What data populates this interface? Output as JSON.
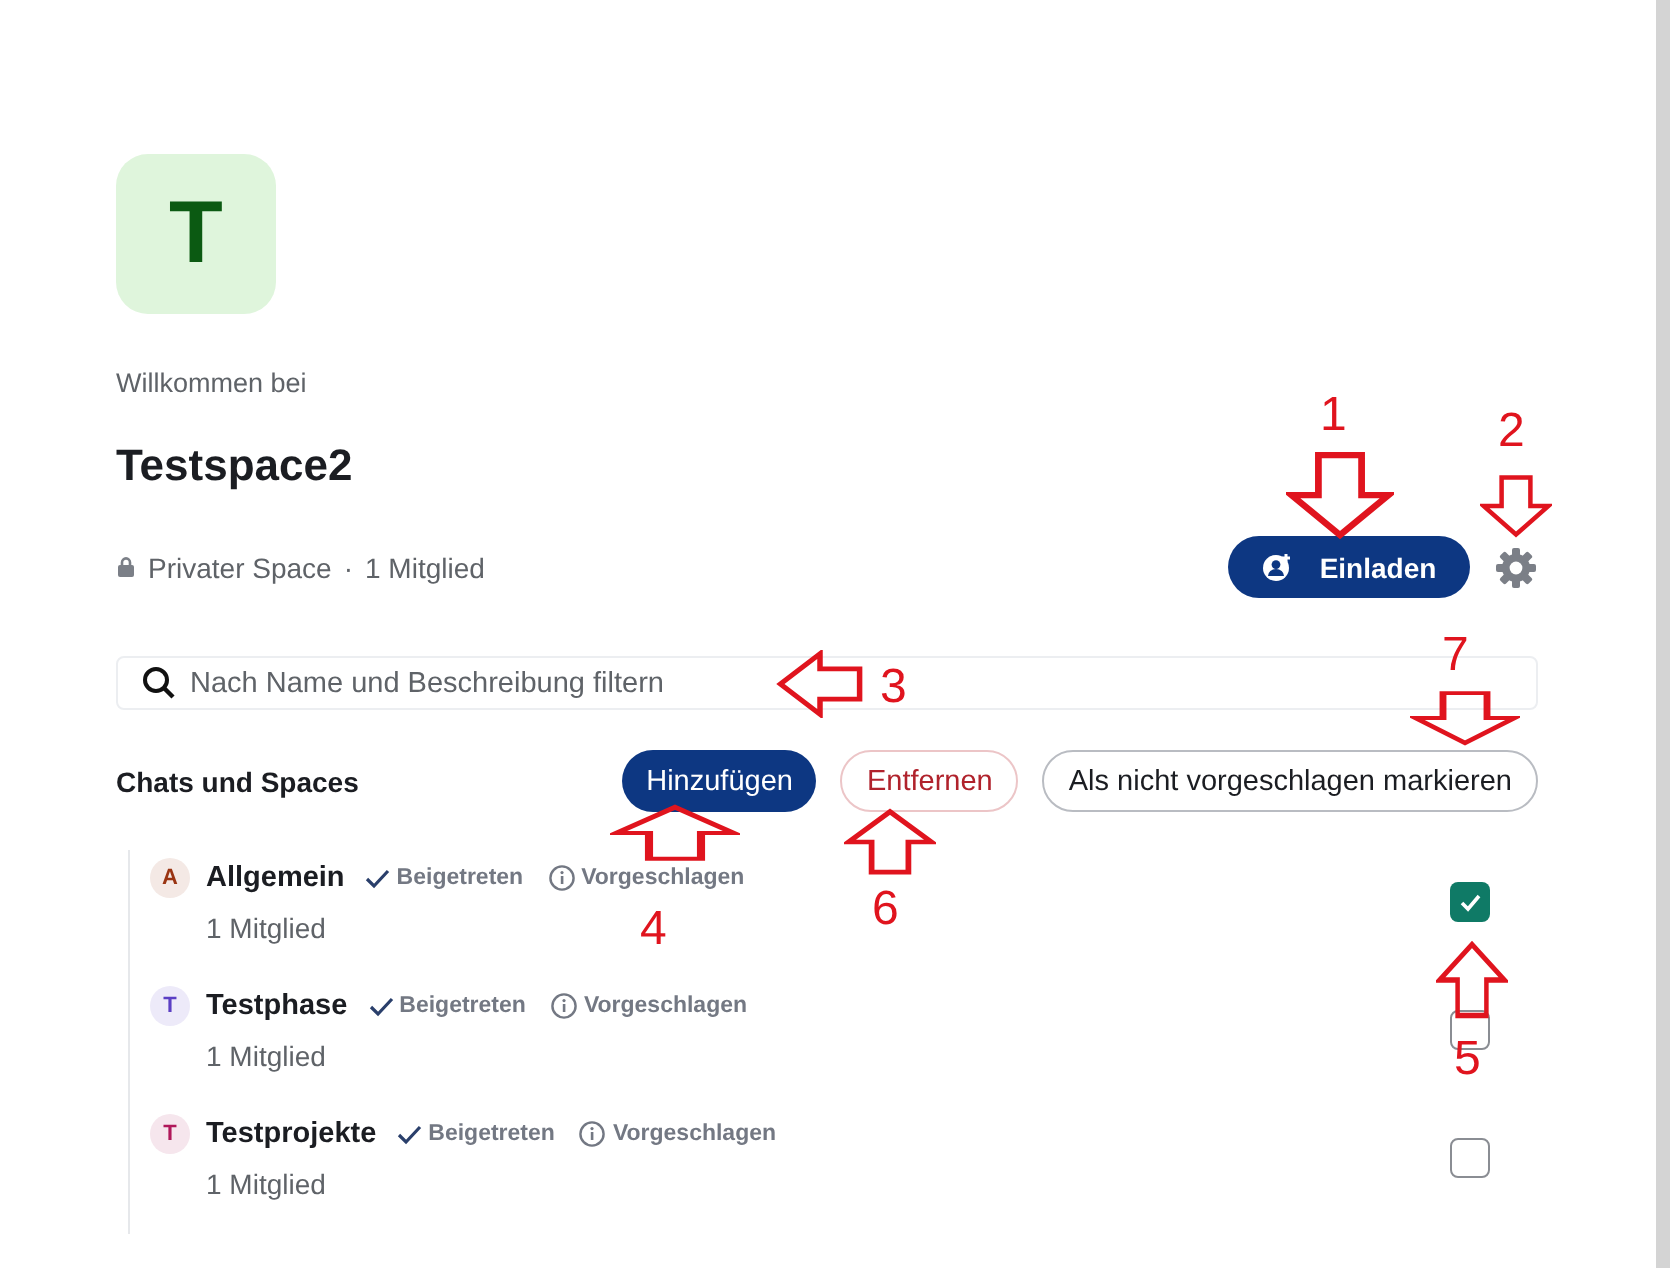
{
  "space": {
    "initial": "T",
    "welcome": "Willkommen bei",
    "name": "Testspace2",
    "privacy": "Privater Space",
    "separator": "·",
    "members": "1 Mitglied",
    "invite_button": "Einladen"
  },
  "search": {
    "placeholder": "Nach Name und Beschreibung filtern"
  },
  "section": {
    "title": "Chats und Spaces",
    "buttons": [
      {
        "label": "Hinzufügen",
        "kind": "primary"
      },
      {
        "label": "Entfernen",
        "kind": "danger"
      },
      {
        "label": "Als nicht vorgeschlagen markieren",
        "kind": "outline"
      }
    ]
  },
  "rooms": [
    {
      "initial": "A",
      "name": "Allgemein",
      "color": "#9a3412",
      "joined": true,
      "joined_label": "Beigetreten",
      "suggested": true,
      "suggested_label": "Vorgeschlagen",
      "members": "1 Mitglied",
      "checked": true
    },
    {
      "initial": "T",
      "name": "Testphase",
      "color": "#5b3fc4",
      "joined": true,
      "joined_label": "Beigetreten",
      "suggested": true,
      "suggested_label": "Vorgeschlagen",
      "members": "1 Mitglied",
      "checked": false
    },
    {
      "initial": "T",
      "name": "Testprojekte",
      "color": "#b0185a",
      "joined": true,
      "joined_label": "Beigetreten",
      "suggested": true,
      "suggested_label": "Vorgeschlagen",
      "members": "1 Mitglied",
      "checked": false
    }
  ],
  "annotations": [
    {
      "label": "1"
    },
    {
      "label": "2"
    },
    {
      "label": "3"
    },
    {
      "label": "4"
    },
    {
      "label": "5"
    },
    {
      "label": "6"
    },
    {
      "label": "7"
    }
  ]
}
